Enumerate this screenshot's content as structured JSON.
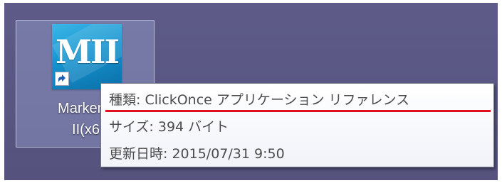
{
  "desktop_icon": {
    "logo_text": "MII",
    "icon": "application-icon",
    "shortcut_icon": "shortcut-arrow-icon",
    "label_line1": "MarkerM",
    "label_line2": "II(x6"
  },
  "tooltip": {
    "type_line": "種類: ClickOnce アプリケーション リファレンス",
    "size_line": "サイズ: 394 バイト",
    "modified_line": "更新日時: 2015/07/31 9:50"
  },
  "colors": {
    "desktop_background": "#5a5784",
    "highlight_underline": "#e01020",
    "icon_blue": "#1593cf"
  }
}
